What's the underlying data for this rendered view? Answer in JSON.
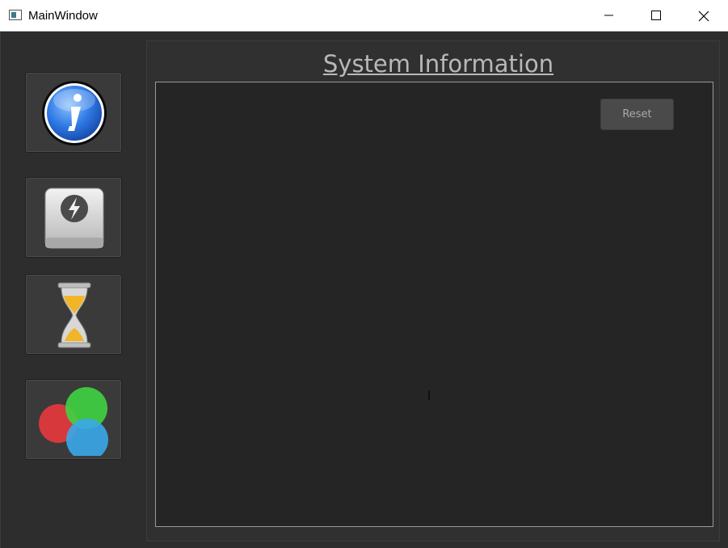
{
  "window": {
    "title": "MainWindow",
    "controls": [
      "minimize",
      "maximize",
      "close"
    ]
  },
  "sidebar": {
    "items": [
      {
        "name": "info",
        "icon": "info-icon"
      },
      {
        "name": "drive",
        "icon": "drive-icon"
      },
      {
        "name": "timer",
        "icon": "hourglass-icon"
      },
      {
        "name": "color",
        "icon": "color-circles-icon"
      }
    ]
  },
  "main": {
    "title": "System Information",
    "reset_label": "Reset"
  },
  "colors": {
    "background": "#2d2d2d",
    "panel": "#303030",
    "content": "#252525",
    "title_text": "#b8b8b8"
  }
}
